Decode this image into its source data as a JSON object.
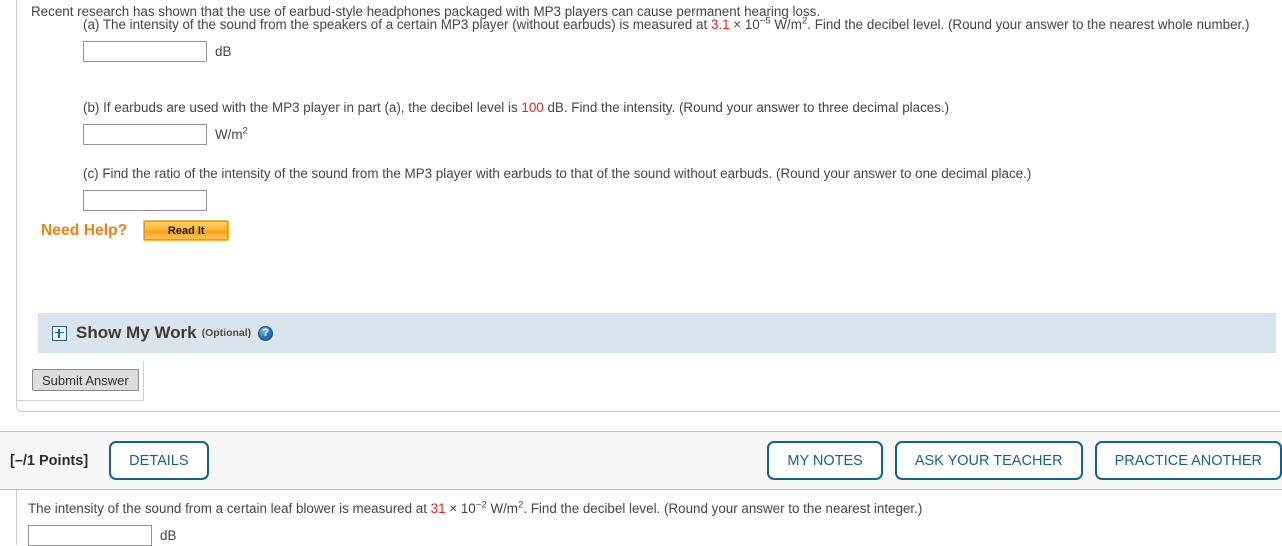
{
  "question": {
    "intro": "Recent research has shown that the use of earbud-style headphones packaged with MP3 players can cause permanent hearing loss.",
    "parts": [
      {
        "label": "(a)",
        "text_before": "(a) The intensity of the sound from the speakers of a certain MP3 player (without earbuds) is measured at ",
        "value": "3.1",
        "text_mid": " × 10",
        "exponent": "−5",
        "unit_inline": " W/m",
        "unit_exp": "2",
        "text_after": ". Find the decibel level. (Round your answer to the nearest whole number.)",
        "answer_value": "",
        "answer_placeholder": "",
        "answer_unit": "dB"
      },
      {
        "label": "(b)",
        "text_before": "(b) If earbuds are used with the MP3 player in part (a), the decibel level is ",
        "value": "100",
        "text_after": " dB. Find the intensity. (Round your answer to three decimal places.)",
        "answer_value": "",
        "answer_placeholder": "",
        "answer_unit": "W/m",
        "answer_unit_exp": "2"
      },
      {
        "label": "(c)",
        "text_full": "(c) Find the ratio of the intensity of the sound from the MP3 player with earbuds to that of the sound without earbuds. (Round your answer to one decimal place.)",
        "answer_value": "",
        "answer_placeholder": "",
        "answer_unit": ""
      }
    ],
    "need_help_label": "Need Help?",
    "read_it_label": "Read It",
    "show_my_work": {
      "title": "Show My Work",
      "optional": "(Optional)",
      "expand_icon": "plus-box-icon",
      "help_icon": "question-mark-icon"
    },
    "submit_label": "Submit Answer"
  },
  "points_bar": {
    "points_label": "[–/1 Points]",
    "details_label": "DETAILS",
    "my_notes_label": "MY NOTES",
    "ask_teacher_label": "ASK YOUR TEACHER",
    "practice_another_label": "PRACTICE ANOTHER"
  },
  "next_question": {
    "text_before": "The intensity of the sound from a certain leaf blower is measured at ",
    "value": "31",
    "text_mid": " × 10",
    "exponent": "−2",
    "unit_inline": " W/m",
    "unit_exp": "2",
    "text_after": ". Find the decibel level. (Round your answer to the nearest integer.)",
    "answer_value": "",
    "answer_placeholder": "",
    "answer_unit": "dB"
  },
  "colors": {
    "accent_blue": "#12628f",
    "highlight_red": "#e8231f",
    "need_help_orange": "#f08010",
    "smw_bar_blue": "#d9e4ee"
  }
}
